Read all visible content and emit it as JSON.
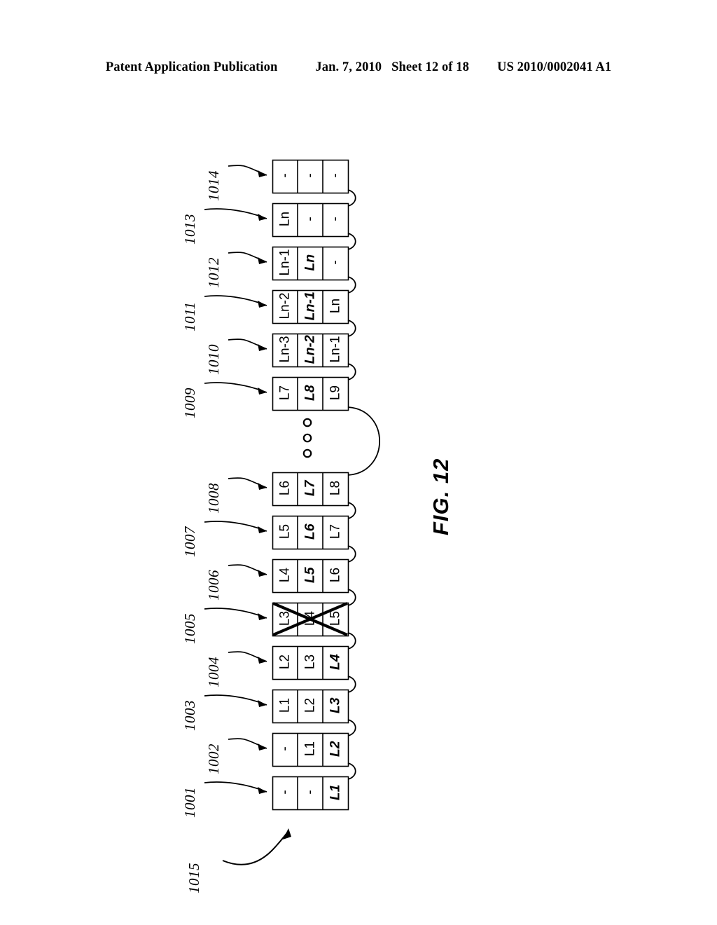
{
  "header": {
    "publication": "Patent Application Publication",
    "date": "Jan. 7, 2010",
    "sheet": "Sheet 12 of 18",
    "patent_number": "US 2010/0002041 A1"
  },
  "figure": {
    "caption": "FIG. 12",
    "overall_ref": "1015",
    "ellipsis_symbol": "o",
    "empty_cell": "-",
    "rows": [
      {
        "ref": "1014",
        "cells": [
          "-",
          "-",
          "-"
        ],
        "highlight": -1,
        "crossed": false
      },
      {
        "ref": "1013",
        "cells": [
          "Ln",
          "-",
          "-"
        ],
        "highlight": -1,
        "crossed": false
      },
      {
        "ref": "1012",
        "cells": [
          "Ln-1",
          "Ln",
          "-"
        ],
        "highlight": 1,
        "crossed": false
      },
      {
        "ref": "1011",
        "cells": [
          "Ln-2",
          "Ln-1",
          "Ln"
        ],
        "highlight": 1,
        "crossed": false
      },
      {
        "ref": "1010",
        "cells": [
          "Ln-3",
          "Ln-2",
          "Ln-1"
        ],
        "highlight": 1,
        "crossed": false
      },
      {
        "ref": "1009",
        "cells": [
          "L7",
          "L8",
          "L9"
        ],
        "highlight": 1,
        "crossed": false
      },
      {
        "ref": "1008",
        "cells": [
          "L6",
          "L7",
          "L8"
        ],
        "highlight": 1,
        "crossed": false
      },
      {
        "ref": "1007",
        "cells": [
          "L5",
          "L6",
          "L7"
        ],
        "highlight": 1,
        "crossed": false
      },
      {
        "ref": "1006",
        "cells": [
          "L4",
          "L5",
          "L6"
        ],
        "highlight": 1,
        "crossed": false
      },
      {
        "ref": "1005",
        "cells": [
          "L3",
          "L4",
          "L5"
        ],
        "highlight": -1,
        "crossed": true
      },
      {
        "ref": "1004",
        "cells": [
          "L2",
          "L3",
          "L4"
        ],
        "highlight": 2,
        "crossed": false
      },
      {
        "ref": "1003",
        "cells": [
          "L1",
          "L2",
          "L3"
        ],
        "highlight": 2,
        "crossed": false
      },
      {
        "ref": "1002",
        "cells": [
          "-",
          "L1",
          "L2"
        ],
        "highlight": 2,
        "crossed": false
      },
      {
        "ref": "1001",
        "cells": [
          "-",
          "-",
          "L1"
        ],
        "highlight": 2,
        "crossed": false
      }
    ]
  }
}
